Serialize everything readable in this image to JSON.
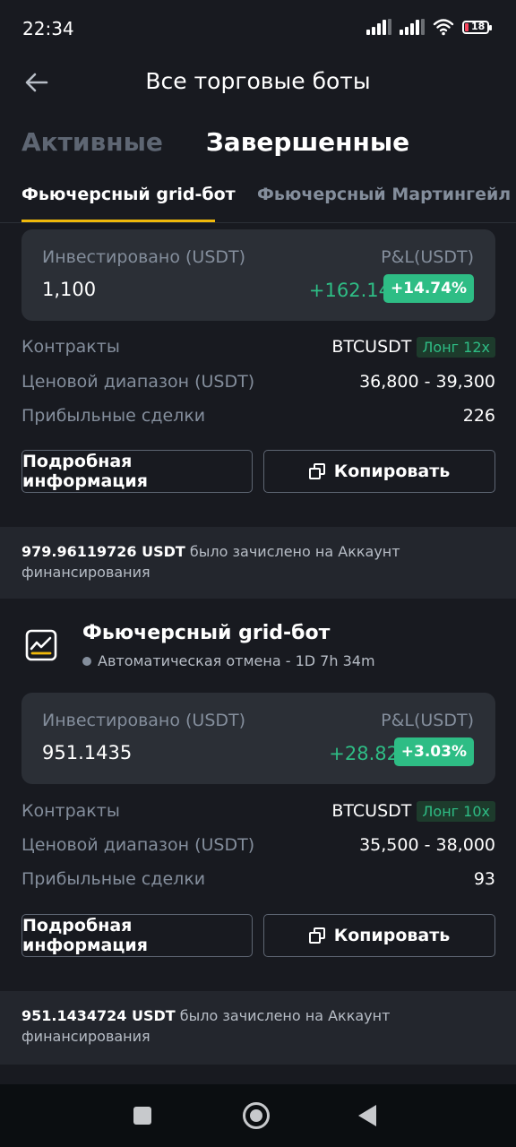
{
  "status_bar": {
    "time": "22:34",
    "battery": "18"
  },
  "header": {
    "title": "Все торговые боты"
  },
  "main_tabs": [
    {
      "label": "Активные"
    },
    {
      "label": "Завершенные"
    }
  ],
  "sub_tabs": [
    {
      "label": "Фьючерсный grid-бот"
    },
    {
      "label": "Фьючерсный Мартингейл"
    }
  ],
  "labels": {
    "invested": "Инвестировано (USDT)",
    "pnl": "P&L(USDT)",
    "contracts": "Контракты",
    "price_range": "Ценовой диапазон (USDT)",
    "profitable_trades": "Прибыльные сделки",
    "details_button": "Подробная информация",
    "copy_button": "Копировать",
    "credited_text": "было зачислено на Аккаунт финансирования"
  },
  "bots": [
    {
      "invested": "1,100",
      "pnl": "+162.14",
      "pnl_pct": "+14.74%",
      "contract": "BTCUSDT",
      "leverage": "Лонг 12x",
      "price_range": "36,800 - 39,300",
      "profitable_trades": "226",
      "credited_amount": "979.96119726 USDT"
    },
    {
      "name": "Фьючерсный grid-бот",
      "status": "Автоматическая отмена - 1D 7h 34m",
      "invested": "951.1435",
      "pnl": "+28.82",
      "pnl_pct": "+3.03%",
      "contract": "BTCUSDT",
      "leverage": "Лонг 10x",
      "price_range": "35,500 - 38,000",
      "profitable_trades": "93",
      "credited_amount": "951.1434724 USDT"
    }
  ],
  "colors": {
    "profit": "#2ebd85",
    "accent": "#f0b90b",
    "background": "#181a20",
    "card": "#2b2f36"
  },
  "icons": [
    "wifi-icon",
    "back-arrow-icon",
    "copy-icon",
    "grid-bot-icon",
    "recents-icon",
    "home-icon",
    "back-nav-icon"
  ]
}
